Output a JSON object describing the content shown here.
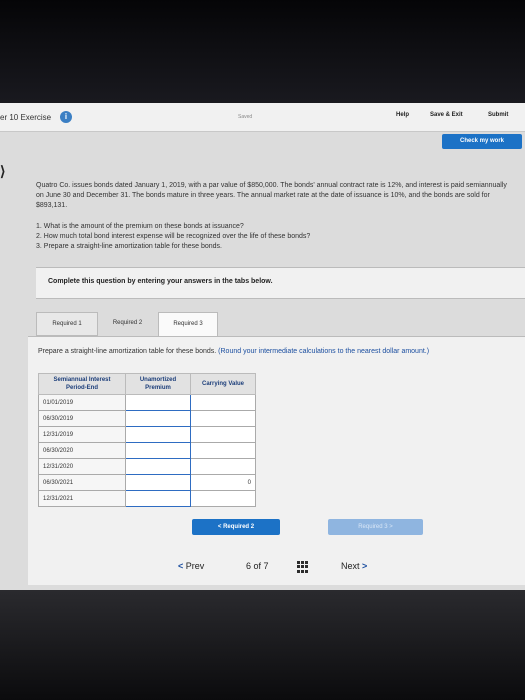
{
  "header": {
    "exercise_title": "er 10 Exercise",
    "info_icon": "i",
    "saved_label": "Saved",
    "help": "Help",
    "save_exit": "Save & Exit",
    "submit": "Submit",
    "check_my_work": "Check my work"
  },
  "problem": {
    "text": "Quatro Co. issues bonds dated January 1, 2019, with a par value of $850,000. The bonds' annual contract rate is 12%, and interest is paid semiannually on June 30 and December 31. The bonds mature in three years. The annual market rate at the date of issuance is 10%, and the bonds are sold for $893,131.",
    "questions": [
      "1. What is the amount of the premium on these bonds at issuance?",
      "2. How much total bond interest expense will be recognized over the life of these bonds?",
      "3. Prepare a straight-line amortization table for these bonds."
    ]
  },
  "panel": {
    "instruction": "Complete this question by entering your answers in the tabs below."
  },
  "tabs": [
    "Required 1",
    "Required 2",
    "Required 3"
  ],
  "content": {
    "instruction": "Prepare a straight-line amortization table for these bonds.",
    "note": "(Round your intermediate calculations to the nearest dollar amount.)"
  },
  "table": {
    "headers": [
      "Semiannual Interest Period-End",
      "Unamortized Premium",
      "Carrying Value"
    ],
    "rows": [
      {
        "date": "01/01/2019",
        "carrying": ""
      },
      {
        "date": "06/30/2019",
        "carrying": ""
      },
      {
        "date": "12/31/2019",
        "carrying": ""
      },
      {
        "date": "06/30/2020",
        "carrying": ""
      },
      {
        "date": "12/31/2020",
        "carrying": ""
      },
      {
        "date": "06/30/2021",
        "carrying": "0"
      },
      {
        "date": "12/31/2021",
        "carrying": ""
      }
    ]
  },
  "nav": {
    "required_prev": "Required 2",
    "required_next": "Required 3",
    "prev": "Prev",
    "page": "6",
    "of": "of 7",
    "next": "Next"
  }
}
